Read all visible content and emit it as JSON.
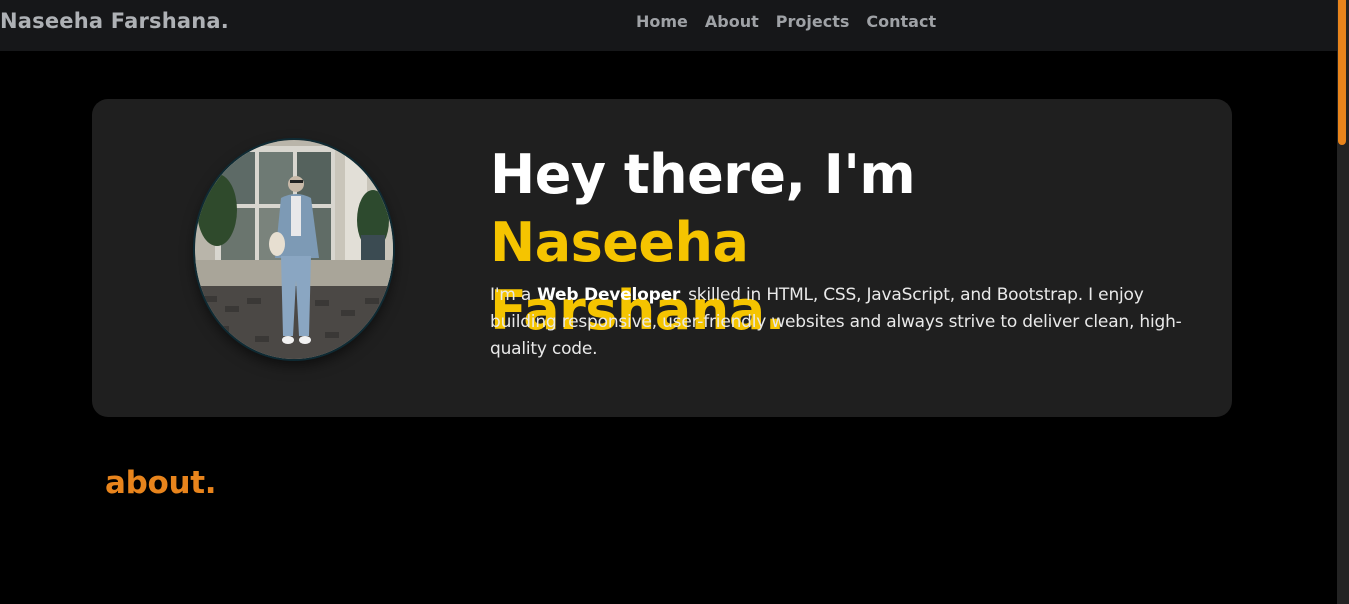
{
  "navbar": {
    "brand": "Naseeha Farshana.",
    "links": [
      "Home",
      "About",
      "Projects",
      "Contact"
    ]
  },
  "hero": {
    "greeting": "Hey there, I'm ",
    "name_line1": "Naseeha",
    "name_line2": "Farshana.",
    "desc_prefix": "I'm a",
    "role": "Web Developer",
    "desc_suffix": "skilled in HTML, CSS, JavaScript, and Bootstrap. I enjoy building responsive, user-friendly websites and always strive to deliver clean, high-quality code."
  },
  "about": {
    "heading": "about."
  },
  "colors": {
    "accent_yellow": "#f5c400",
    "accent_orange": "#e8841c",
    "card_bg": "#1f1f1f",
    "navbar_bg": "#161719"
  }
}
